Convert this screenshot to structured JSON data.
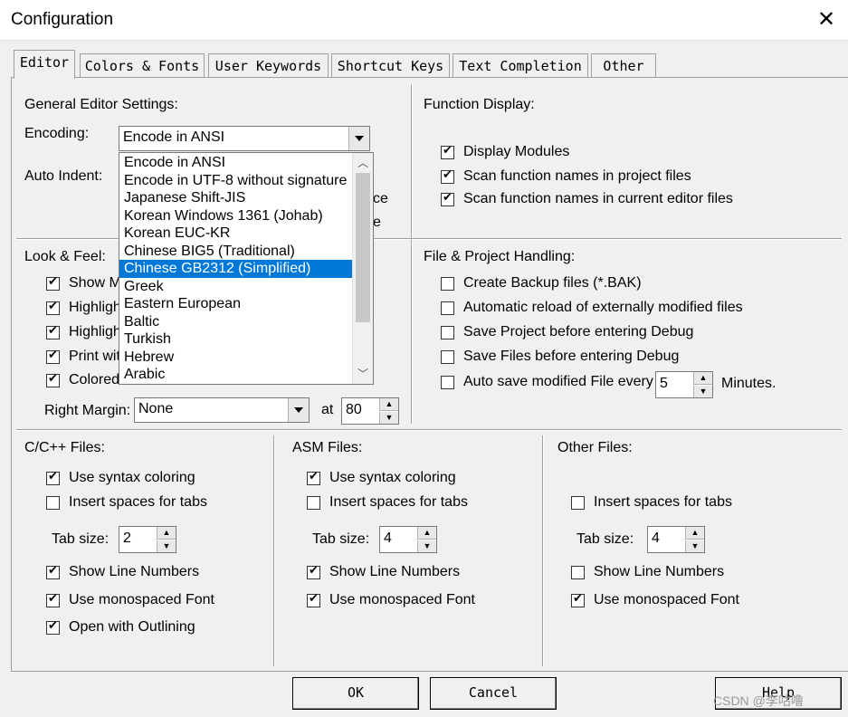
{
  "window": {
    "title": "Configuration",
    "close_glyph": "✕"
  },
  "tabs": [
    "Editor",
    "Colors & Fonts",
    "User Keywords",
    "Shortcut Keys",
    "Text Completion",
    "Other"
  ],
  "general": {
    "heading": "General Editor Settings:",
    "encoding_label": "Encoding:",
    "encoding_value": "Encode in ANSI",
    "auto_indent_label": "Auto Indent:",
    "partial_1": "ce",
    "partial_2": "e"
  },
  "encoding_options": [
    "Encode in ANSI",
    "Encode in UTF-8 without signature",
    "Japanese Shift-JIS",
    "Korean Windows 1361 (Johab)",
    "Korean EUC-KR",
    "Chinese BIG5 (Traditional)",
    "Chinese GB2312 (Simplified)",
    "Greek",
    "Eastern European",
    "Baltic",
    "Turkish",
    "Hebrew",
    "Arabic"
  ],
  "encoding_selected_index": 6,
  "function_display": {
    "heading": "Function Display:",
    "items": [
      {
        "label": "Display Modules",
        "checked": true
      },
      {
        "label": "Scan function names in project files",
        "checked": true
      },
      {
        "label": "Scan function names in current editor files",
        "checked": true
      }
    ]
  },
  "look_feel": {
    "heading": "Look & Feel:",
    "items": [
      {
        "label": "Show M",
        "checked": true
      },
      {
        "label": "Highligh",
        "checked": true
      },
      {
        "label": "Highligh",
        "checked": true
      },
      {
        "label": "Print wit",
        "checked": true
      },
      {
        "label": "Colored",
        "checked": true
      }
    ],
    "right_margin_label": "Right Margin:",
    "right_margin_value": "None",
    "at_label": "at",
    "at_value": "80"
  },
  "file_project": {
    "heading": "File & Project Handling:",
    "items": [
      {
        "label": "Create Backup files (*.BAK)",
        "checked": false
      },
      {
        "label": "Automatic reload of externally modified files",
        "checked": false
      },
      {
        "label": "Save Project before entering Debug",
        "checked": false
      },
      {
        "label": "Save Files before entering Debug",
        "checked": false
      },
      {
        "label": "Auto save modified File every",
        "checked": false
      }
    ],
    "autosave_value": "5",
    "minutes_label": "Minutes."
  },
  "cpp": {
    "heading": "C/C++ Files:",
    "use_syntax": "Use syntax coloring",
    "insert_spaces": "Insert spaces for tabs",
    "tab_size_label": "Tab size:",
    "tab_size": "2",
    "show_line": "Show Line Numbers",
    "monospace": "Use monospaced Font",
    "outlining": "Open with Outlining"
  },
  "asm": {
    "heading": "ASM Files:",
    "use_syntax": "Use syntax coloring",
    "insert_spaces": "Insert spaces for tabs",
    "tab_size_label": "Tab size:",
    "tab_size": "4",
    "show_line": "Show Line Numbers",
    "monospace": "Use monospaced Font"
  },
  "other": {
    "heading": "Other Files:",
    "insert_spaces": "Insert spaces for tabs",
    "tab_size_label": "Tab size:",
    "tab_size": "4",
    "show_line": "Show Line Numbers",
    "monospace": "Use monospaced Font"
  },
  "buttons": {
    "ok": "OK",
    "cancel": "Cancel",
    "help": "Help"
  },
  "watermark": "CSDN @李咕噜"
}
